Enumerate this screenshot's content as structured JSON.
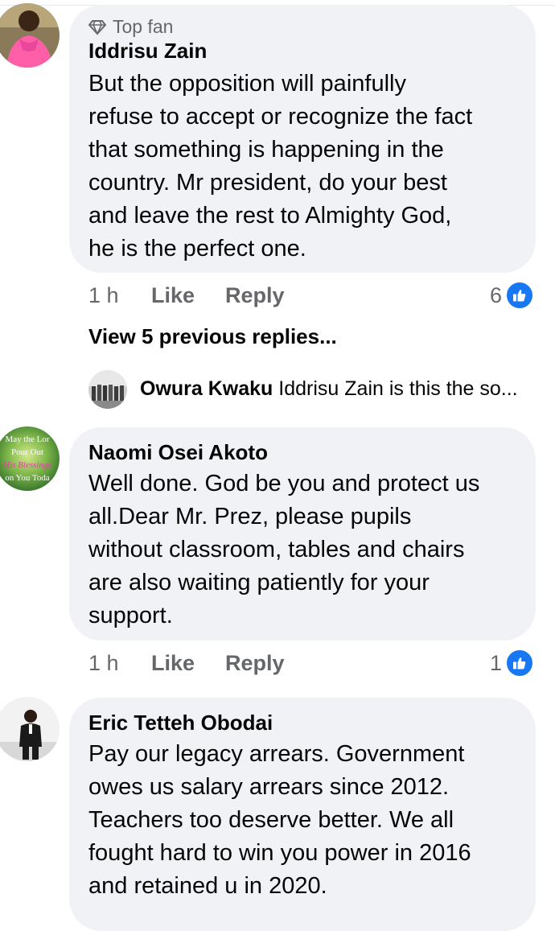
{
  "comments": [
    {
      "badge": "Top fan",
      "author": "Iddrisu Zain",
      "text": "But the opposition will painfully\nrefuse to accept or recognize the fact\nthat something is happening in the\ncountry. Mr president, do your best\nand leave the rest to Almighty God,\nhe is the perfect one.",
      "time": "1 h",
      "like_label": "Like",
      "reply_label": "Reply",
      "reaction_count": "6",
      "reaction_icon": "thumbs-up-icon"
    },
    {
      "author": "Naomi Osei Akoto",
      "avatar_lines": [
        "May the Lor",
        "Pour Out",
        "His Blessings",
        "on You Toda"
      ],
      "text": "Well done. God be you and protect us\nall.Dear Mr. Prez, please pupils\nwithout classroom, tables and chairs\nare also waiting patiently for  your\nsupport.",
      "time": "1 h",
      "like_label": "Like",
      "reply_label": "Reply",
      "reaction_count": "1",
      "reaction_icon": "thumbs-up-icon"
    },
    {
      "author": "Eric Tetteh Obodai",
      "text": "Pay our legacy arrears. Government\nowes us salary arrears since 2012.\nTeachers too deserve better. We all\nfought hard to win you power in 2016\nand retained u in 2020."
    }
  ],
  "replies": {
    "view_previous": "View 5 previous replies...",
    "preview_author": "Owura Kwaku",
    "preview_text": "Iddrisu Zain is this the so..."
  },
  "colors": {
    "bubble": "#f0f2f5",
    "meta_text": "#65676b",
    "like_blue": "#1877f2"
  }
}
